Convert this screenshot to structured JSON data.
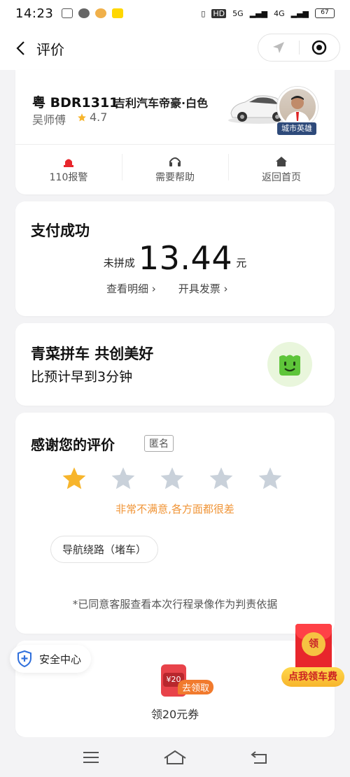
{
  "status_bar": {
    "time": "14:23",
    "network": "5G",
    "network2": "4G",
    "battery": "67"
  },
  "nav": {
    "title": "评价"
  },
  "driver": {
    "plate": "粤 BDR1311",
    "car_model": "吉利汽车帝豪·白色",
    "name": "吴师傅",
    "rating": "4.7",
    "badge": "城市英雄"
  },
  "actions": [
    {
      "label": "110报警",
      "icon": "alarm-icon"
    },
    {
      "label": "需要帮助",
      "icon": "headset-icon"
    },
    {
      "label": "返回首页",
      "icon": "home-icon"
    }
  ],
  "payment": {
    "title": "支付成功",
    "prefix": "未拼成",
    "amount": "13.44",
    "unit": "元",
    "detail_link": "查看明细 ›",
    "invoice_link": "开具发票 ›"
  },
  "promo": {
    "title": "青菜拼车 共创美好",
    "subtitle": "比预计早到3分钟"
  },
  "rating_section": {
    "title": "感谢您的评价",
    "anonymous_tag": "匿名",
    "stars_selected": 1,
    "stars_total": 5,
    "description": "非常不满意,各方面都很差",
    "tag_chip": "导航绕路（堵车）",
    "agreement": "*已同意客服查看本次行程录像作为判责依据"
  },
  "coupon": {
    "badge": "去领取",
    "value": "¥20",
    "text": "领20元券"
  },
  "safety": {
    "label": "安全中心"
  },
  "red_packet": {
    "coin": "领",
    "label": "点我领车费"
  },
  "colors": {
    "star_active": "#f7b52c",
    "star_inactive": "#c9d1da",
    "accent_orange": "#f09436",
    "alarm_red": "#e8262c"
  }
}
